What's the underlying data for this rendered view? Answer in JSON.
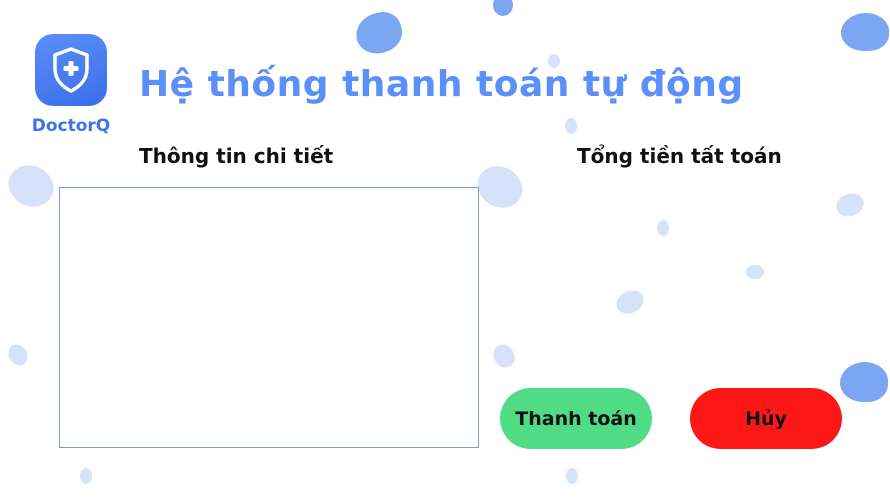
{
  "logo": {
    "icon": "shield-plus-icon",
    "text": "DoctorQ"
  },
  "header": {
    "title": "Hệ thống thanh toán tự động"
  },
  "sections": {
    "details_heading": "Thông tin chi tiết",
    "total_heading": "Tổng tiền tất toán"
  },
  "details": {
    "value": ""
  },
  "total": {
    "value": ""
  },
  "actions": {
    "pay_label": "Thanh toán",
    "cancel_label": "Hủy"
  },
  "colors": {
    "accent": "#5b8ff9",
    "pay_button": "#4fdc84",
    "cancel_button": "#ff1616",
    "blob_dark": "#7da6f2",
    "blob_light": "#d6e2fa"
  }
}
